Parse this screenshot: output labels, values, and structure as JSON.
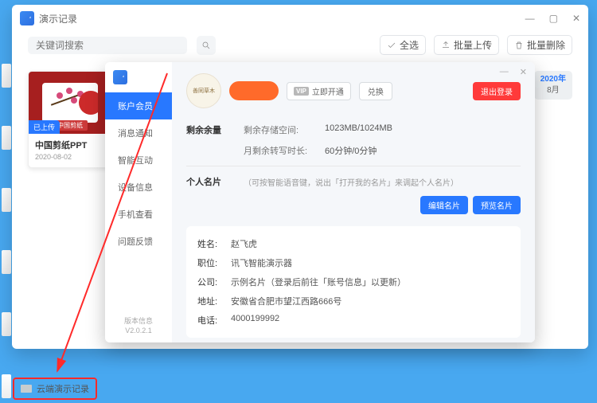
{
  "window": {
    "title": "演示记录"
  },
  "search": {
    "placeholder": "关键词搜索"
  },
  "toolbar": {
    "select_all": "全选",
    "bulk_upload": "批量上传",
    "bulk_delete": "批量删除"
  },
  "card": {
    "uploaded_badge": "已上传",
    "thumb_label": "中国剪纸",
    "title": "中国剪纸PPT",
    "date": "2020-08-02"
  },
  "date_group": {
    "year": "2020年",
    "month": "8月"
  },
  "sidebar": {
    "items": [
      {
        "label": "账户会员"
      },
      {
        "label": "消息通知"
      },
      {
        "label": "智能互动"
      },
      {
        "label": "设备信息"
      },
      {
        "label": "手机查看"
      },
      {
        "label": "问题反馈"
      }
    ]
  },
  "version": {
    "label": "版本信息",
    "value": "V2.0.2.1"
  },
  "avatar_text": "善同草木",
  "vip_open": "立即开通",
  "exchange": "兑换",
  "logout": "退出登录",
  "remain": {
    "section_label": "剩余余量",
    "storage_key": "剩余存储空间:",
    "storage_val": "1023MB/1024MB",
    "time_key": "月剩余转写时长:",
    "time_val": "60分钟/0分钟"
  },
  "card_section": {
    "label": "个人名片",
    "hint": "（可按智能语音键，说出「打开我的名片」来调起个人名片）",
    "edit": "编辑名片",
    "preview": "预览名片"
  },
  "biz": {
    "rows": [
      {
        "key": "姓名:",
        "val": "赵飞虎"
      },
      {
        "key": "职位:",
        "val": "讯飞智能演示器"
      },
      {
        "key": "公司:",
        "val": "示例名片（登录后前往「账号信息」以更新）"
      },
      {
        "key": "地址:",
        "val": "安徽省合肥市望江西路666号"
      },
      {
        "key": "电话:",
        "val": "4000199992"
      }
    ]
  },
  "bottom_tab": "云端演示记录"
}
